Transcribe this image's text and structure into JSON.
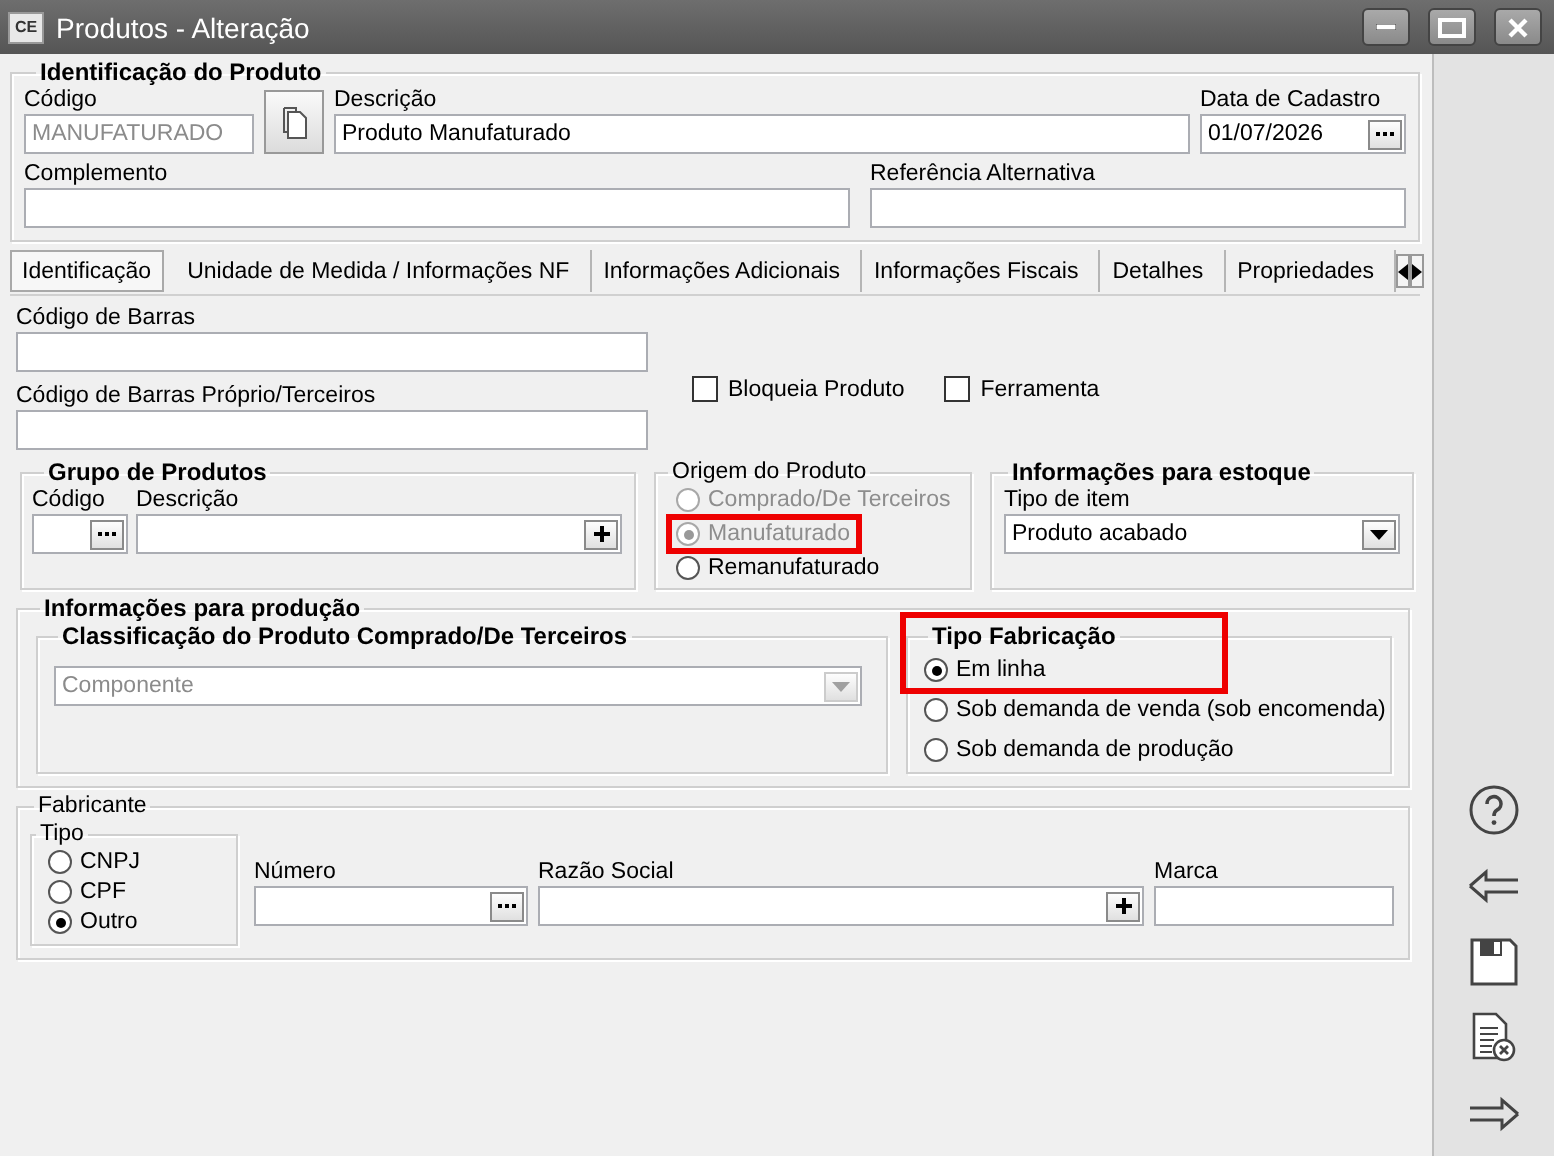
{
  "window": {
    "title": "Produtos - Alteração",
    "icon_text": "CE"
  },
  "identificacao_produto": {
    "title": "Identificação do Produto",
    "codigo": {
      "label": "Código",
      "value": "MANUFATURADO",
      "disabled": true
    },
    "descricao": {
      "label": "Descrição",
      "value": "Produto Manufaturado"
    },
    "data_cadastro": {
      "label": "Data de Cadastro",
      "value": "01/07/2026"
    },
    "complemento": {
      "label": "Complemento"
    },
    "referencia_alternativa": {
      "label": "Referência Alternativa"
    }
  },
  "tabs": [
    {
      "label": "Identificação",
      "selected": true
    },
    {
      "label": "Unidade de Medida / Informações NF",
      "selected": false
    },
    {
      "label": "Informações Adicionais",
      "selected": false
    },
    {
      "label": "Informações Fiscais",
      "selected": false
    },
    {
      "label": "Detalhes",
      "selected": false
    },
    {
      "label": "Propriedades",
      "selected": false
    }
  ],
  "codigo_barras": {
    "label": "Código de Barras"
  },
  "codigo_barras_proprio": {
    "label": "Código de Barras Próprio/Terceiros"
  },
  "checkboxes": [
    {
      "label": "Bloqueia Produto",
      "checked": false
    },
    {
      "label": "Ferramenta",
      "checked": false
    }
  ],
  "grupo_produtos": {
    "title": "Grupo de Produtos",
    "codigo_label": "Código",
    "descricao_label": "Descrição"
  },
  "origem_produto": {
    "title": "Origem do Produto",
    "options": [
      {
        "label": "Comprado/De Terceiros",
        "selected": false,
        "disabled": true,
        "highlighted": false
      },
      {
        "label": "Manufaturado",
        "selected": true,
        "disabled": true,
        "highlighted": true
      },
      {
        "label": "Remanufaturado",
        "selected": false,
        "disabled": false,
        "highlighted": false
      }
    ]
  },
  "estoque": {
    "title": "Informações para estoque",
    "tipo_item": {
      "label": "Tipo de item",
      "value": "Produto acabado"
    }
  },
  "producao": {
    "title": "Informações para produção",
    "classificacao": {
      "title": "Classificação do Produto Comprado/De Terceiros",
      "value": "Componente",
      "disabled": true
    },
    "tipo_fabricacao": {
      "title": "Tipo Fabricação",
      "highlighted": true,
      "options": [
        {
          "label": "Em linha",
          "selected": true
        },
        {
          "label": "Sob demanda de venda (sob encomenda)",
          "selected": false
        },
        {
          "label": "Sob demanda de produção",
          "selected": false
        }
      ]
    }
  },
  "fabricante": {
    "title": "Fabricante",
    "tipo": {
      "title": "Tipo",
      "options": [
        {
          "label": "CNPJ",
          "selected": false
        },
        {
          "label": "CPF",
          "selected": false
        },
        {
          "label": "Outro",
          "selected": true
        }
      ]
    },
    "numero_label": "Número",
    "razao_social_label": "Razão Social",
    "marca_label": "Marca"
  }
}
